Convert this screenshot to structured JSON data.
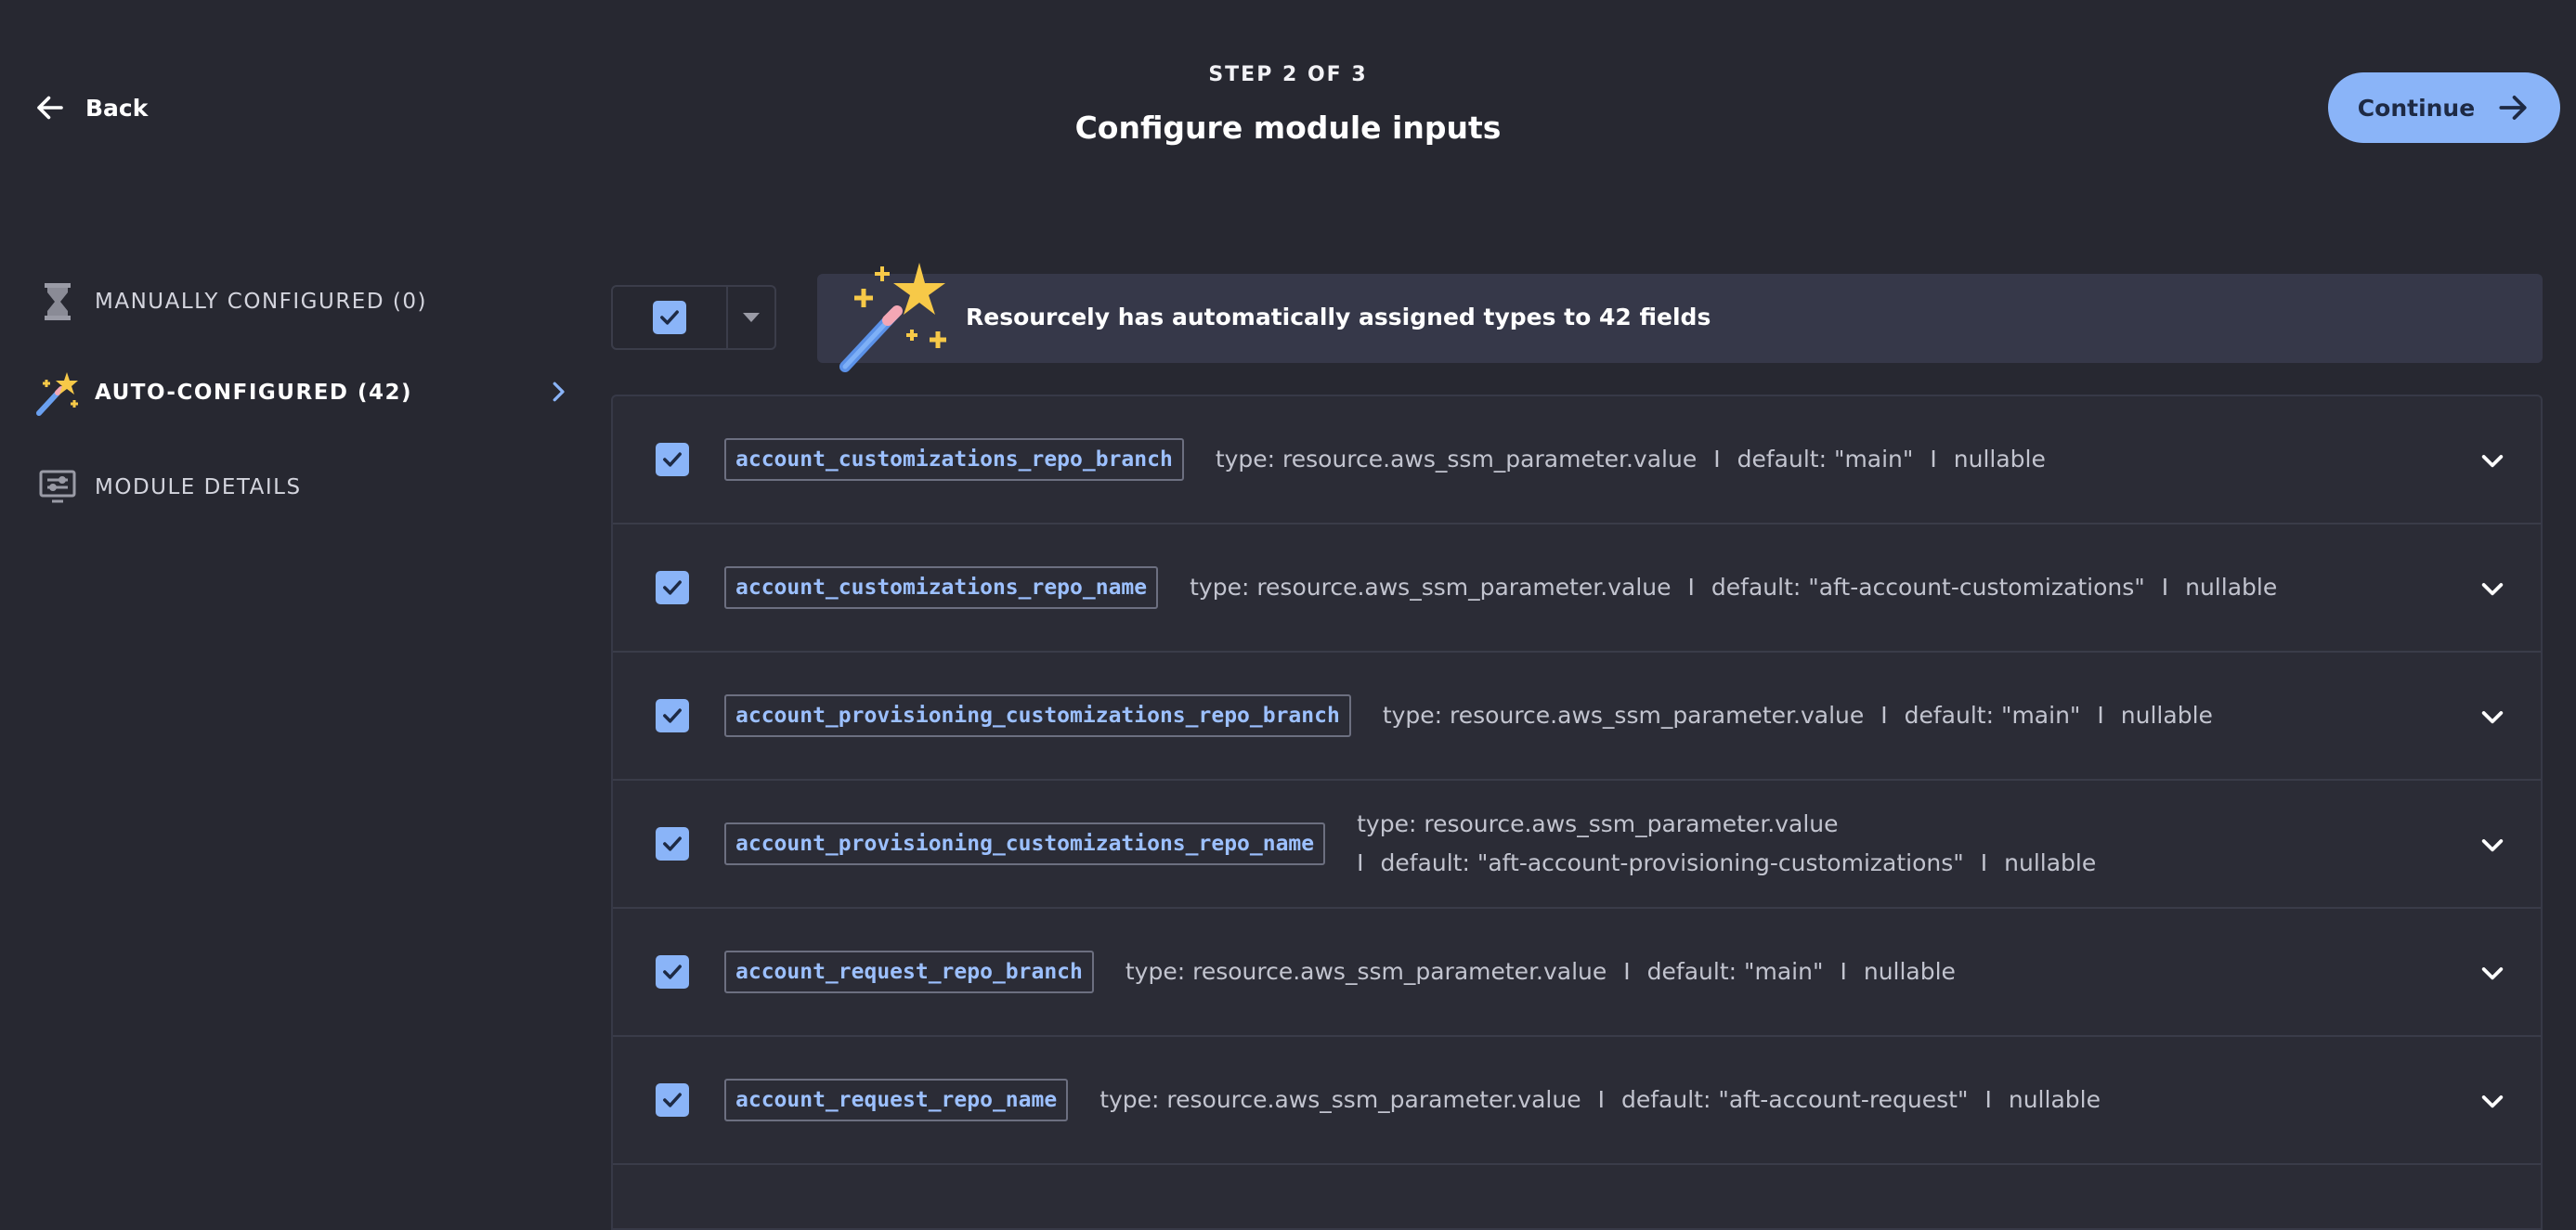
{
  "header": {
    "back_label": "Back",
    "step_label": "STEP 2 OF 3",
    "title": "Configure module inputs",
    "continue_label": "Continue"
  },
  "sidebar": {
    "items": [
      {
        "label": "MANUALLY CONFIGURED (0)",
        "icon": "hourglass-icon"
      },
      {
        "label": "AUTO-CONFIGURED (42)",
        "icon": "magic-wand-icon",
        "active": true
      },
      {
        "label": "MODULE DETAILS",
        "icon": "module-details-icon"
      }
    ]
  },
  "banner": {
    "text": "Resourcely has automatically assigned types to 42 fields"
  },
  "fields": [
    {
      "name": "account_customizations_repo_branch",
      "type": "type: resource.aws_ssm_parameter.value",
      "default": "default: \"main\"",
      "nullable": "nullable"
    },
    {
      "name": "account_customizations_repo_name",
      "type": "type: resource.aws_ssm_parameter.value",
      "default": "default: \"aft-account-customizations\"",
      "nullable": "nullable"
    },
    {
      "name": "account_provisioning_customizations_repo_branch",
      "type": "type: resource.aws_ssm_parameter.value",
      "default": "default: \"main\"",
      "nullable": "nullable"
    },
    {
      "name": "account_provisioning_customizations_repo_name",
      "type": "type: resource.aws_ssm_parameter.value",
      "default": "default: \"aft-account-provisioning-customizations\"",
      "nullable": "nullable"
    },
    {
      "name": "account_request_repo_branch",
      "type": "type: resource.aws_ssm_parameter.value",
      "default": "default: \"main\"",
      "nullable": "nullable"
    },
    {
      "name": "account_request_repo_name",
      "type": "type: resource.aws_ssm_parameter.value",
      "default": "default: \"aft-account-request\"",
      "nullable": "nullable"
    }
  ],
  "separator": "I",
  "colors": {
    "background": "#272831",
    "accent": "#8ab4f8",
    "banner": "#363849",
    "field_name": "#9cc0ff"
  }
}
